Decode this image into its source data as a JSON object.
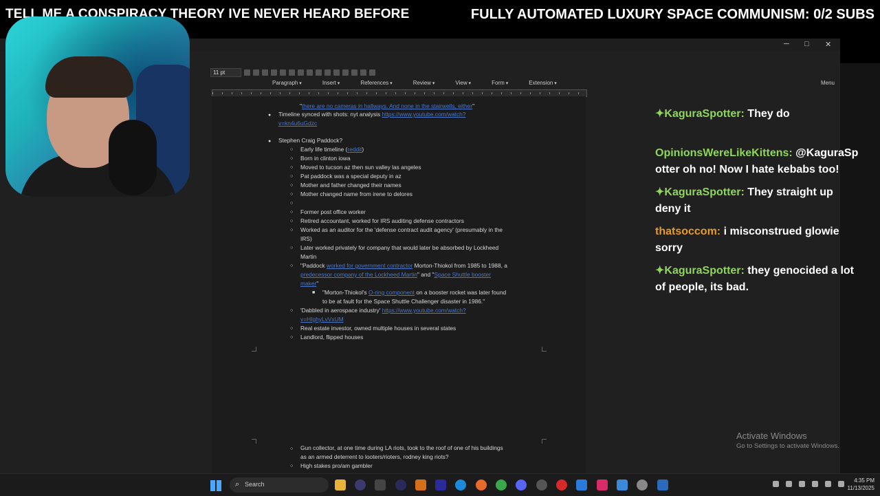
{
  "stream": {
    "banner_left": "TELL ME A CONSPIRACY THEORY IVE NEVER HEARD BEFORE",
    "banner_right": "FULLY AUTOMATED LUXURY SPACE COMMUNISM: 0/2 SUBS"
  },
  "editor": {
    "window_controls": {
      "minimize": "─",
      "maximize": "□",
      "close": "✕"
    },
    "font_size": "11 pt",
    "menus": [
      "Paragraph",
      "Insert",
      "References",
      "Review",
      "View",
      "Form",
      "Extension"
    ],
    "menu_button": "Menu"
  },
  "document": {
    "top_link": "there are no cameras in hallways. And none in the stairwells, either",
    "timeline_text": "Timeline synced with shots: nyt analysis ",
    "timeline_link_1": "https://www.youtube.com/watch?",
    "timeline_link_2": "v=kn4u6uGdzc",
    "heading": "Stephen Craig Paddock?",
    "items": [
      "Early life timeline (",
      "Born in clinton iowa",
      "Moved to tucson az then sun valley las angeles",
      "Pat paddock was a special deputy in az",
      "Mother and father changed their names",
      "Mother changed name from irene to delores",
      "",
      "Former post office worker",
      "Retired accountant, worked for IRS auditing defense contractors",
      "Worked as an auditor for the 'defense contract audit agency' (presumably in the",
      "IRS)",
      "Later worked privately for company that would later be absorbed by Lockheed",
      "Martin"
    ],
    "early_life_link": "reddit",
    "early_life_close": ")",
    "paddock_1a": "\"Paddock ",
    "paddock_1b": "worked for government contractor",
    "paddock_1c": " Morton-Thiokol from 1985 to 1988, a",
    "paddock_2a": "predecessor company of the Lockheed Martin",
    "paddock_2b": "\" and \"",
    "paddock_2c": "Space Shuttle booster",
    "paddock_3a": "maker",
    "paddock_3b": "\"",
    "sub_1a": "\"Morton-Thiokol's ",
    "sub_1b": "O-ring component",
    "sub_1c": " on a booster rocket was later found",
    "sub_2": "to be at fault for the Space Shuttle Challenger disaster in 1986.\"",
    "aero_a": "'Dabbled in aerospace industry' ",
    "aero_link_1": "https://www.youtube.com/watch?",
    "aero_link_2": "v=HIghyLvVxUM",
    "real_estate": "Real estate investor, owned multiple houses in several states",
    "landlord": "Landlord, flipped houses",
    "gun_1": "Gun collector, at one time during LA riots, took to the roof of one of his buildings",
    "gun_2": "as an armed deterrent to looters/rioters, rodney king riots?",
    "gambler": "High stakes pro/am gambler"
  },
  "chat": [
    {
      "user": "KaguraSpotter",
      "message": "They do",
      "color": "#8fd65b",
      "badge": "star-icon"
    },
    {
      "user": "OpinionsWereLikeKittens",
      "message": "@KaguraSpotter oh no! Now I hate kebabs too!",
      "color": "#8fd65b"
    },
    {
      "user": "KaguraSpotter",
      "message": "They straight up deny it",
      "color": "#8fd65b",
      "badge": "star-icon"
    },
    {
      "user": "thatsoccom",
      "message": "i misconstrued glowie sorry",
      "color": "#e89a2a"
    },
    {
      "user": "KaguraSpotter",
      "message": "they genocided a lot of people, its bad.",
      "color": "#8fd65b",
      "badge": "star-icon"
    }
  ],
  "chat_display": {
    "m1_user": "KaguraSpotter:",
    "m1_text": " They do",
    "m2_user": "OpinionsWereLikeKittens:",
    "m2_text": " @KaguraSp",
    "m2_line2": "otter oh no! Now I hate kebabs too!",
    "m3_user": "KaguraSpotter:",
    "m3_text": " They straight up",
    "m3_line2": "deny it",
    "m4_user": "thatsoccom:",
    "m4_text": " i misconstrued glowie",
    "m4_line2": "sorry",
    "m5_user": "KaguraSpotter:",
    "m5_text": " they genocided a lot",
    "m5_line2": "of people, its bad."
  },
  "windows": {
    "activate_title": "Activate Windows",
    "activate_sub": "Go to Settings to activate Windows.",
    "search_label": "Search",
    "time": "4:35 PM",
    "date": "11/13/2025"
  },
  "colors": {
    "chat_green": "#8fd65b",
    "chat_orange": "#e89a2a",
    "link_blue": "#4a78c8"
  }
}
